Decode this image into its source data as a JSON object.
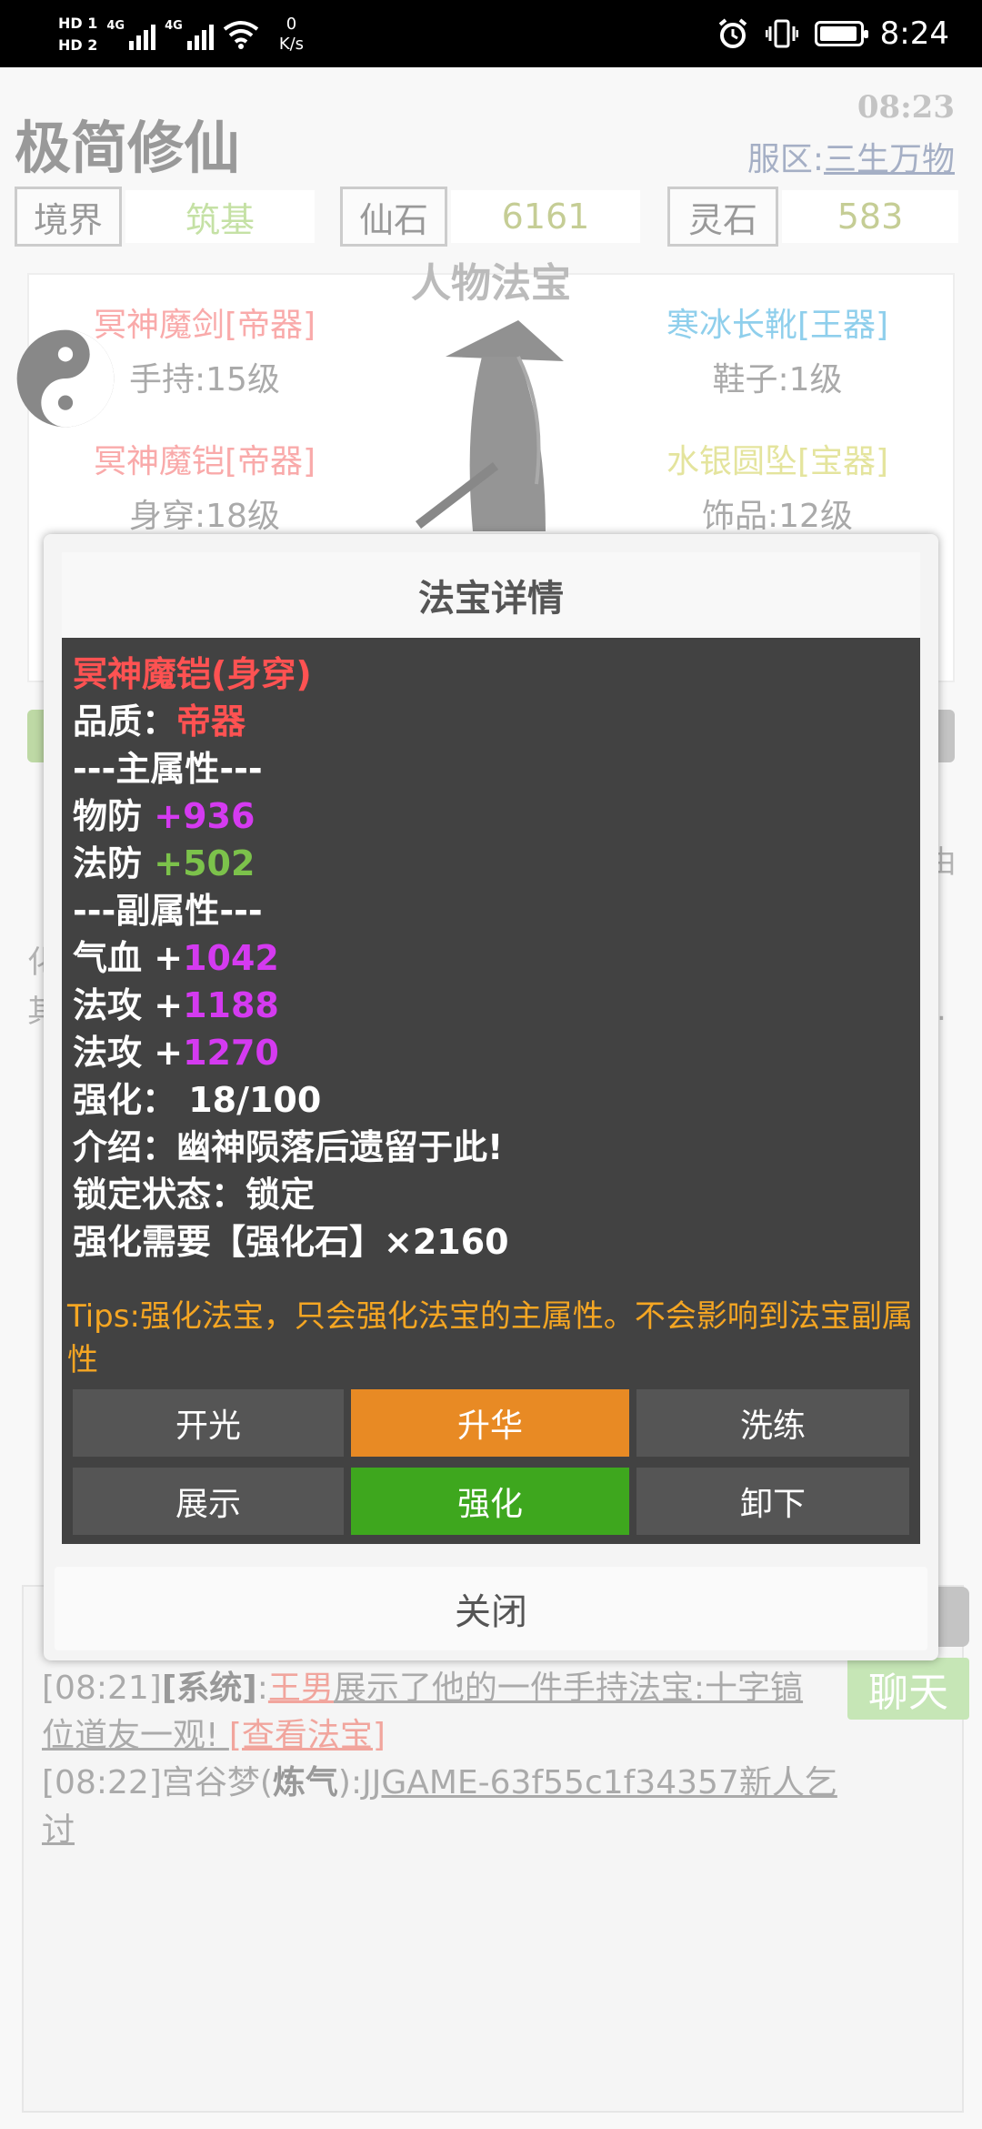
{
  "status_bar": {
    "hd1": "HD 1",
    "hd2": "HD 2",
    "net_type1": "4G",
    "net_type2": "4G",
    "net_speed_value": "0",
    "net_speed_unit": "K/s",
    "time": "8:24",
    "icons": [
      "alarm-icon",
      "vibrate-icon",
      "battery-icon",
      "wifi-icon",
      "signal-icon"
    ]
  },
  "header": {
    "title": "极简修仙",
    "time": "08:23",
    "server_label": "服区:",
    "server_name": "三生万物"
  },
  "stats": [
    {
      "label": "境界",
      "value": "筑基",
      "color": "#8bc34a"
    },
    {
      "label": "仙石",
      "value": "6161",
      "color": "#8a9a2a"
    },
    {
      "label": "灵石",
      "value": "583",
      "color": "#8a9a2a"
    }
  ],
  "equipment": {
    "heading": "人物法宝",
    "items": [
      {
        "name": "冥神魔剑[帝器]",
        "slot": "手持:15级",
        "color": "#f25555"
      },
      {
        "name": "寒冰长靴[王器]",
        "slot": "鞋子:1级",
        "color": "#1e9fd8"
      },
      {
        "name": "冥神魔铠[帝器]",
        "slot": "身穿:18级",
        "color": "#f25555"
      },
      {
        "name": "水银圆坠[宝器]",
        "slot": "饰品:12级",
        "color": "#c8c83a"
      }
    ]
  },
  "background_fragments": {
    "left1": "化",
    "left2": "其",
    "right1": "由",
    "right2": "."
  },
  "modal": {
    "title": "法宝详情",
    "item_name": "冥神魔铠(身穿)",
    "quality_label": "品质：",
    "quality_value": "帝器",
    "main_attr_header": "---主属性---",
    "main_attrs": [
      {
        "label": "物防 ",
        "value": "+936"
      },
      {
        "label": "法防 ",
        "value": "+502"
      }
    ],
    "sub_attr_header": "---副属性---",
    "sub_attrs": [
      {
        "label": "气血 +",
        "value": "1042"
      },
      {
        "label": "法攻 +",
        "value": "1188"
      },
      {
        "label": "法攻 +",
        "value": "1270"
      }
    ],
    "enhance": "强化：  18/100",
    "intro": "介绍：幽神陨落后遗留于此!",
    "lock_status": "锁定状态：锁定",
    "enhance_need": "强化需要【强化石】×2160",
    "tips": "Tips:强化法宝，只会强化法宝的主属性。不会影响到法宝副属性",
    "buttons": [
      "开光",
      "升华",
      "洗练",
      "展示",
      "强化",
      "卸下"
    ],
    "close": "关闭"
  },
  "chat": {
    "line1_time": "[08:21]",
    "line1_channel": "[系统]",
    "line1_colon": ":",
    "line1_user": "王男",
    "line1_text": "展示了他的一件手持法宝:十字镐",
    "line2_text": "位道友一观! ",
    "line2_link": "[查看法宝]",
    "line3_time": "[08:22]",
    "line3_user": "宫谷梦(",
    "line3_realm": "炼气",
    "line3_close": "):",
    "line3_text": "JJGAME-63f55c1f34357新人乞讨",
    "chat_button": "聊天",
    "edge_text": "i"
  }
}
